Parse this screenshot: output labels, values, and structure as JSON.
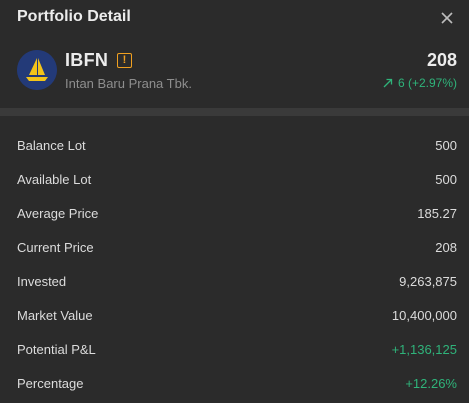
{
  "header": {
    "title": "Portfolio Detail"
  },
  "stock": {
    "code": "IBFN",
    "warning_icon": "!",
    "company": "Intan Baru Prana Tbk.",
    "price": "208",
    "change": "6 (+2.97%)",
    "change_color": "#2fb37a",
    "logo_color": "#233a78",
    "logo_accent": "#f3c419"
  },
  "details": [
    {
      "label": "Balance Lot",
      "value": "500"
    },
    {
      "label": "Available Lot",
      "value": "500"
    },
    {
      "label": "Average Price",
      "value": "185.27"
    },
    {
      "label": "Current Price",
      "value": "208"
    },
    {
      "label": "Invested",
      "value": "9,263,875"
    },
    {
      "label": "Market Value",
      "value": "10,400,000"
    },
    {
      "label": "Potential P&L",
      "value": "+1,136,125"
    },
    {
      "label": "Percentage",
      "value": "+12.26%"
    }
  ]
}
